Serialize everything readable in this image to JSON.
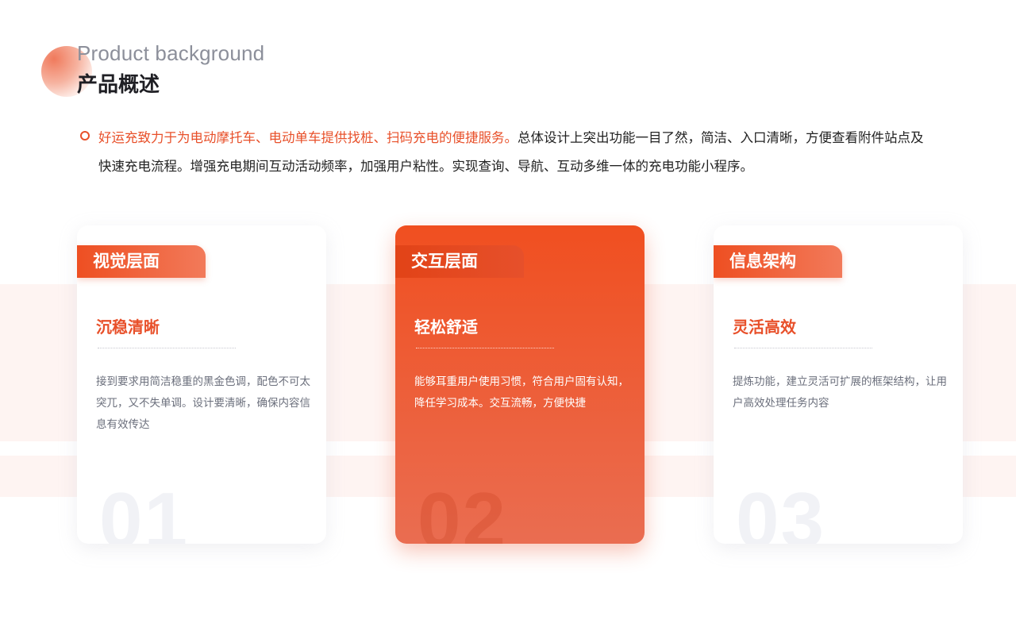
{
  "header": {
    "subtitle_en": "Product background",
    "title_cn": "产品概述"
  },
  "intro": {
    "highlight": "好运充致力于为电动摩托车、电动单车提供找桩、扫码充电的便捷服务。",
    "line1_rest": "总体设计上突出功能一目了然，简洁、入口清晰，方便查看附件站点及",
    "line2": "快速充电流程。增强充电期间互动活动频率，加强用户粘性。实现查询、导航、互动多维一体的充电功能小程序。"
  },
  "cards": [
    {
      "tab": "视觉层面",
      "title": "沉稳清晰",
      "desc": "接到要求用简洁稳重的黑金色调，配色不可太突兀，又不失单调。设计要清晰，确保内容信息有效传达",
      "number": "01"
    },
    {
      "tab": "交互层面",
      "title": "轻松舒适",
      "desc": "能够耳重用户使用习惯，符合用户固有认知，降任学习成本。交互流畅，方便快捷",
      "number": "02"
    },
    {
      "tab": "信息架构",
      "title": "灵活高效",
      "desc": "提炼功能，建立灵活可扩展的框架结构，让用户高效处理任务内容",
      "number": "03"
    }
  ],
  "colors": {
    "accent": "#e8502a",
    "band": "#fef4f2"
  }
}
